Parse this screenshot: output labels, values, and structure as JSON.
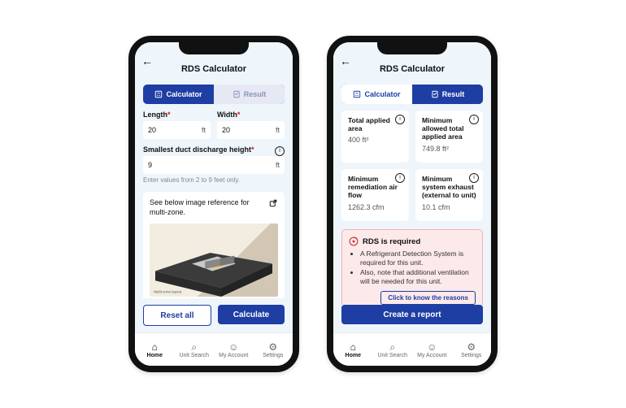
{
  "app": {
    "title": "RDS Calculator"
  },
  "tabs": {
    "calculator": {
      "label": "Calculator"
    },
    "result": {
      "label": "Result"
    }
  },
  "form": {
    "length": {
      "label": "Length",
      "value": "20",
      "unit": "ft"
    },
    "width": {
      "label": "Width",
      "value": "20",
      "unit": "ft"
    },
    "height": {
      "label": "Smallest duct discharge height",
      "value": "9",
      "unit": "ft"
    },
    "height_hint": "Enter values from 2 to 9 feet only."
  },
  "reference": {
    "text": "See below image reference for multi-zone."
  },
  "buttons": {
    "reset": "Reset all",
    "calculate": "Calculate",
    "create_report": "Create a report",
    "reasons": "Click to know the reasons"
  },
  "nav": {
    "home": "Home",
    "unit_search": "Unit Search",
    "my_account": "My Account",
    "settings": "Settings"
  },
  "result": {
    "total_applied_area": {
      "label": "Total applied area",
      "value": "400 ft²"
    },
    "min_allowed_area": {
      "label": "Minimum allowed total applied area",
      "value": "749.8 ft²"
    },
    "min_remediation": {
      "label": "Minimum remediation air flow",
      "value": "1262.3 cfm"
    },
    "min_exhaust": {
      "label": "Minimum system exhaust (external to unit)",
      "value": "10.1 cfm"
    },
    "rds_required": {
      "title": "RDS is required",
      "bullet1": "A Refrigerant Detection System is required for this unit.",
      "bullet2": "Also, note that additional ventilation will be needed for this unit."
    }
  }
}
